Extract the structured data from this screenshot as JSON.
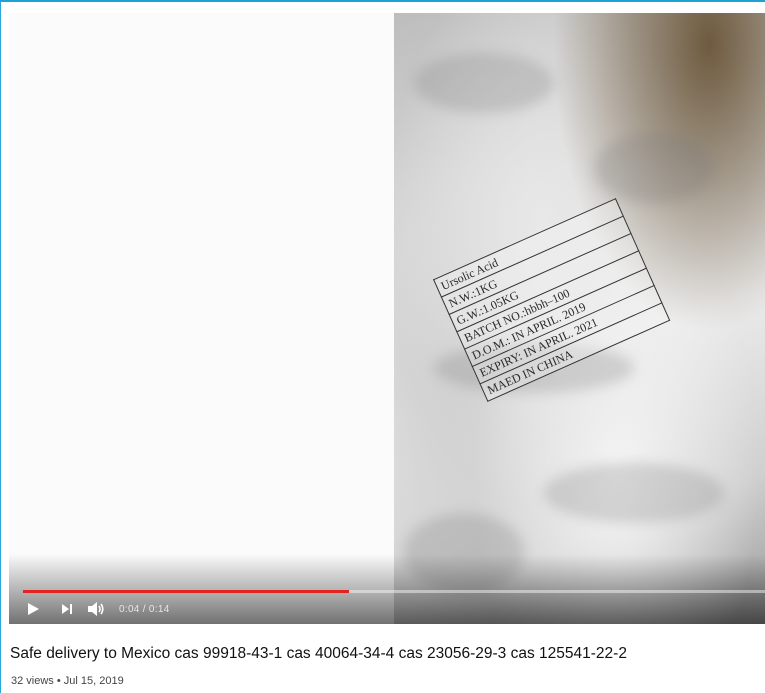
{
  "player": {
    "package_label_lines": [
      "Ursolic Acid",
      "N.W.:1KG",
      "G.W.:1.05KG",
      "BATCH NO.:hbbh–100",
      "D.O.M.: IN APRIL. 2019",
      "EXPIRY: IN APRIL. 2021",
      "MAED IN CHINA"
    ],
    "controls": {
      "play_icon": "play-icon",
      "next_icon": "next-icon",
      "volume_icon": "volume-icon",
      "time_display": "0:04 / 0:14"
    },
    "progress_fraction": 0.44,
    "progress_color": "#e52222"
  },
  "video": {
    "title": "Safe delivery to Mexico cas 99918-43-1 cas 40064-34-4 cas 23056-29-3 cas 125541-22-2",
    "meta": "32 views • Jul 15, 2019"
  },
  "colors": {
    "frame_accent": "#1fa1d6"
  }
}
